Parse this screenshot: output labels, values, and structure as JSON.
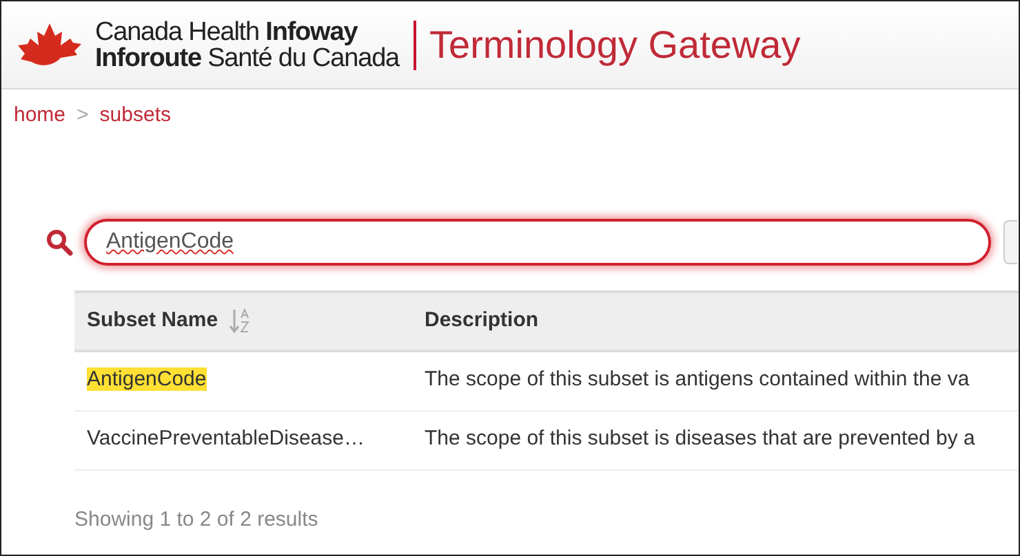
{
  "header": {
    "brand_en": "Canada Health **Infoway**",
    "brand_fr": "**Inforoute** Santé du Canada",
    "title": "Terminology Gateway"
  },
  "breadcrumb": [
    {
      "label": "home"
    },
    {
      "label": "subsets"
    }
  ],
  "breadcrumb_separator": ">",
  "search": {
    "value": "AntigenCode",
    "focused": true
  },
  "table": {
    "columns": [
      {
        "label": "Subset Name",
        "sortable": true
      },
      {
        "label": "Description"
      }
    ],
    "rows": [
      {
        "name": "AntigenCode",
        "highlighted": true,
        "description": "The scope of this subset is antigens contained within the va"
      },
      {
        "name": "VaccinePreventableDisease…",
        "highlighted": false,
        "description": "The scope of this subset is diseases that are prevented by a"
      }
    ]
  },
  "footer": "Showing 1 to 2 of 2 results"
}
